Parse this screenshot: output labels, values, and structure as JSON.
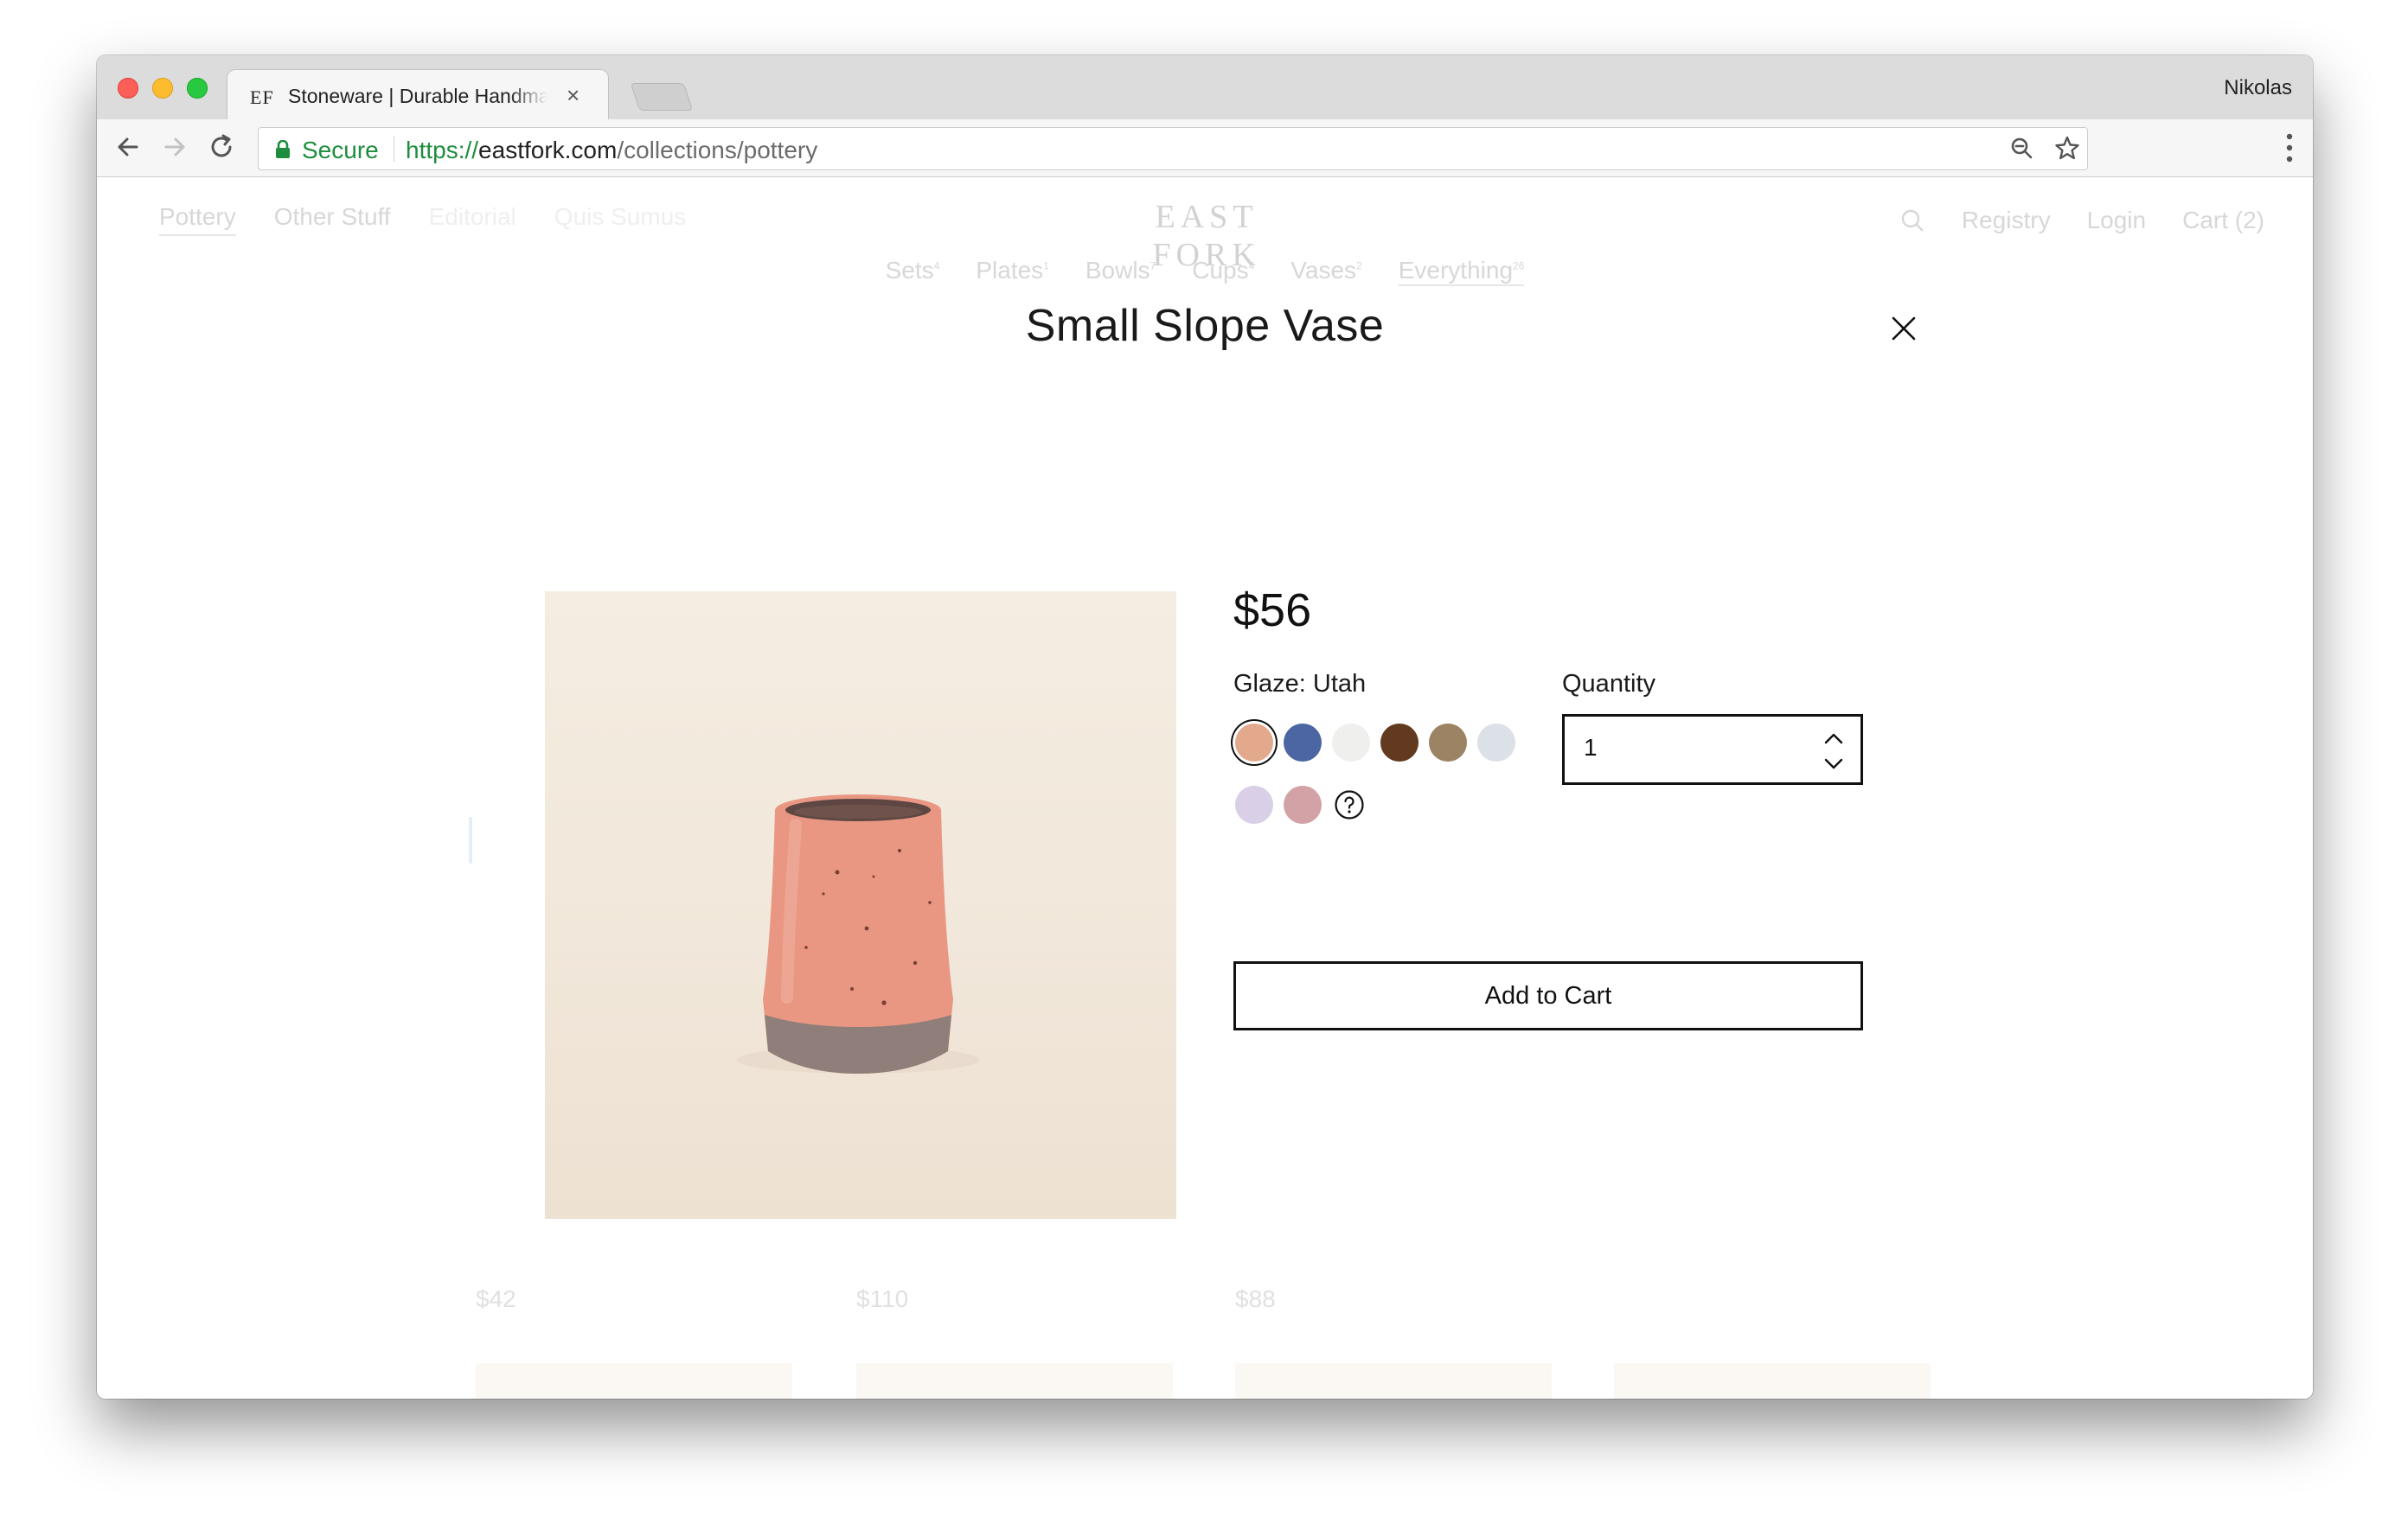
{
  "browser": {
    "tab_title": "Stoneware | Durable Handmade",
    "tab_favicon": "EF",
    "profile_name": "Nikolas",
    "security_label": "Secure",
    "url_scheme": "https://",
    "url_host": "eastfork.com",
    "url_path": "/collections/pottery"
  },
  "site": {
    "logo": "EAST FORK",
    "nav_left": [
      "Pottery",
      "Other Stuff",
      "Editorial",
      "Quis Sumus"
    ],
    "nav_right": [
      "Registry",
      "Login",
      "Cart (2)"
    ],
    "subnav": [
      {
        "label": "Sets",
        "count": "4"
      },
      {
        "label": "Plates",
        "count": "1"
      },
      {
        "label": "Bowls",
        "count": "7"
      },
      {
        "label": "Cups",
        "count": "4"
      },
      {
        "label": "Vases",
        "count": "2"
      },
      {
        "label": "Everything",
        "count": "26"
      }
    ]
  },
  "product": {
    "title": "Small Slope Vase",
    "price": "$56",
    "glaze_label": "Glaze: Utah",
    "quantity_label": "Quantity",
    "quantity_value": "1",
    "add_to_cart_label": "Add to Cart",
    "glaze_swatches": [
      {
        "name": "utah",
        "color": "#e3a98d",
        "selected": true
      },
      {
        "name": "blue",
        "color": "#4b66a3",
        "selected": false
      },
      {
        "name": "white",
        "color": "#efefed",
        "selected": false
      },
      {
        "name": "brown",
        "color": "#613a1f",
        "selected": false
      },
      {
        "name": "taupe",
        "color": "#9c8364",
        "selected": false
      },
      {
        "name": "pale-grey",
        "color": "#dce1e7",
        "selected": false
      },
      {
        "name": "lilac",
        "color": "#d9cfe6",
        "selected": false
      },
      {
        "name": "rose",
        "color": "#d2a2a6",
        "selected": false
      }
    ],
    "image_colors": {
      "vase_glaze": "#e99783",
      "vase_clay": "#8f7e79",
      "background": "#f3ebdf"
    }
  },
  "background_grid": {
    "prices": [
      "$42",
      "$110",
      "$88"
    ]
  }
}
